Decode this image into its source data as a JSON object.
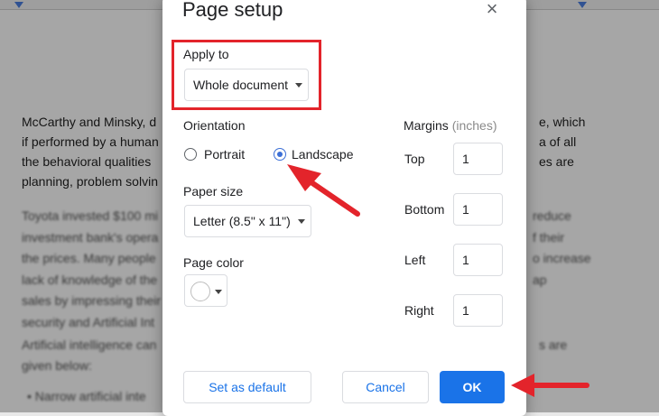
{
  "document": {
    "line1": "McCarthy and Minsky, d",
    "line1_right": "e, which",
    "line2": "if performed by a human",
    "line2_right": "a of all",
    "line3": "the behavioral qualities",
    "line3_right": "es are",
    "line4": "planning, problem solvin",
    "para2": [
      "Toyota invested $100 mi",
      "investment bank's opera",
      "the prices. Many people",
      "lack of knowledge of the",
      "sales by impressing their",
      "security and Artificial Int"
    ],
    "para2_right": [
      "",
      "reduce",
      "f their",
      "o increase",
      "ap",
      ""
    ],
    "para3": [
      "Artificial intelligence can",
      "given below:"
    ],
    "para3_right": [
      "s are",
      ""
    ],
    "bullet": "Narrow artificial inte"
  },
  "dialog": {
    "title": "Page setup",
    "close": "×",
    "apply_to": {
      "label": "Apply to",
      "value": "Whole document"
    },
    "orientation": {
      "label": "Orientation",
      "options": [
        "Portrait",
        "Landscape"
      ],
      "selected": "Landscape"
    },
    "paper_size": {
      "label": "Paper size",
      "value": "Letter (8.5\" x 11\")"
    },
    "page_color": {
      "label": "Page color",
      "value": "#ffffff"
    },
    "margins": {
      "label": "Margins",
      "unit": "(inches)",
      "fields": [
        {
          "label": "Top",
          "value": "1"
        },
        {
          "label": "Bottom",
          "value": "1"
        },
        {
          "label": "Left",
          "value": "1"
        },
        {
          "label": "Right",
          "value": "1"
        }
      ]
    },
    "buttons": {
      "set_default": "Set as default",
      "cancel": "Cancel",
      "ok": "OK"
    }
  },
  "colors": {
    "accent": "#1a73e8",
    "annotation": "#e3242b"
  },
  "icons": {
    "close": "close-icon",
    "dropdown": "chevron-down-icon",
    "annotation": "red-arrow-icon"
  }
}
